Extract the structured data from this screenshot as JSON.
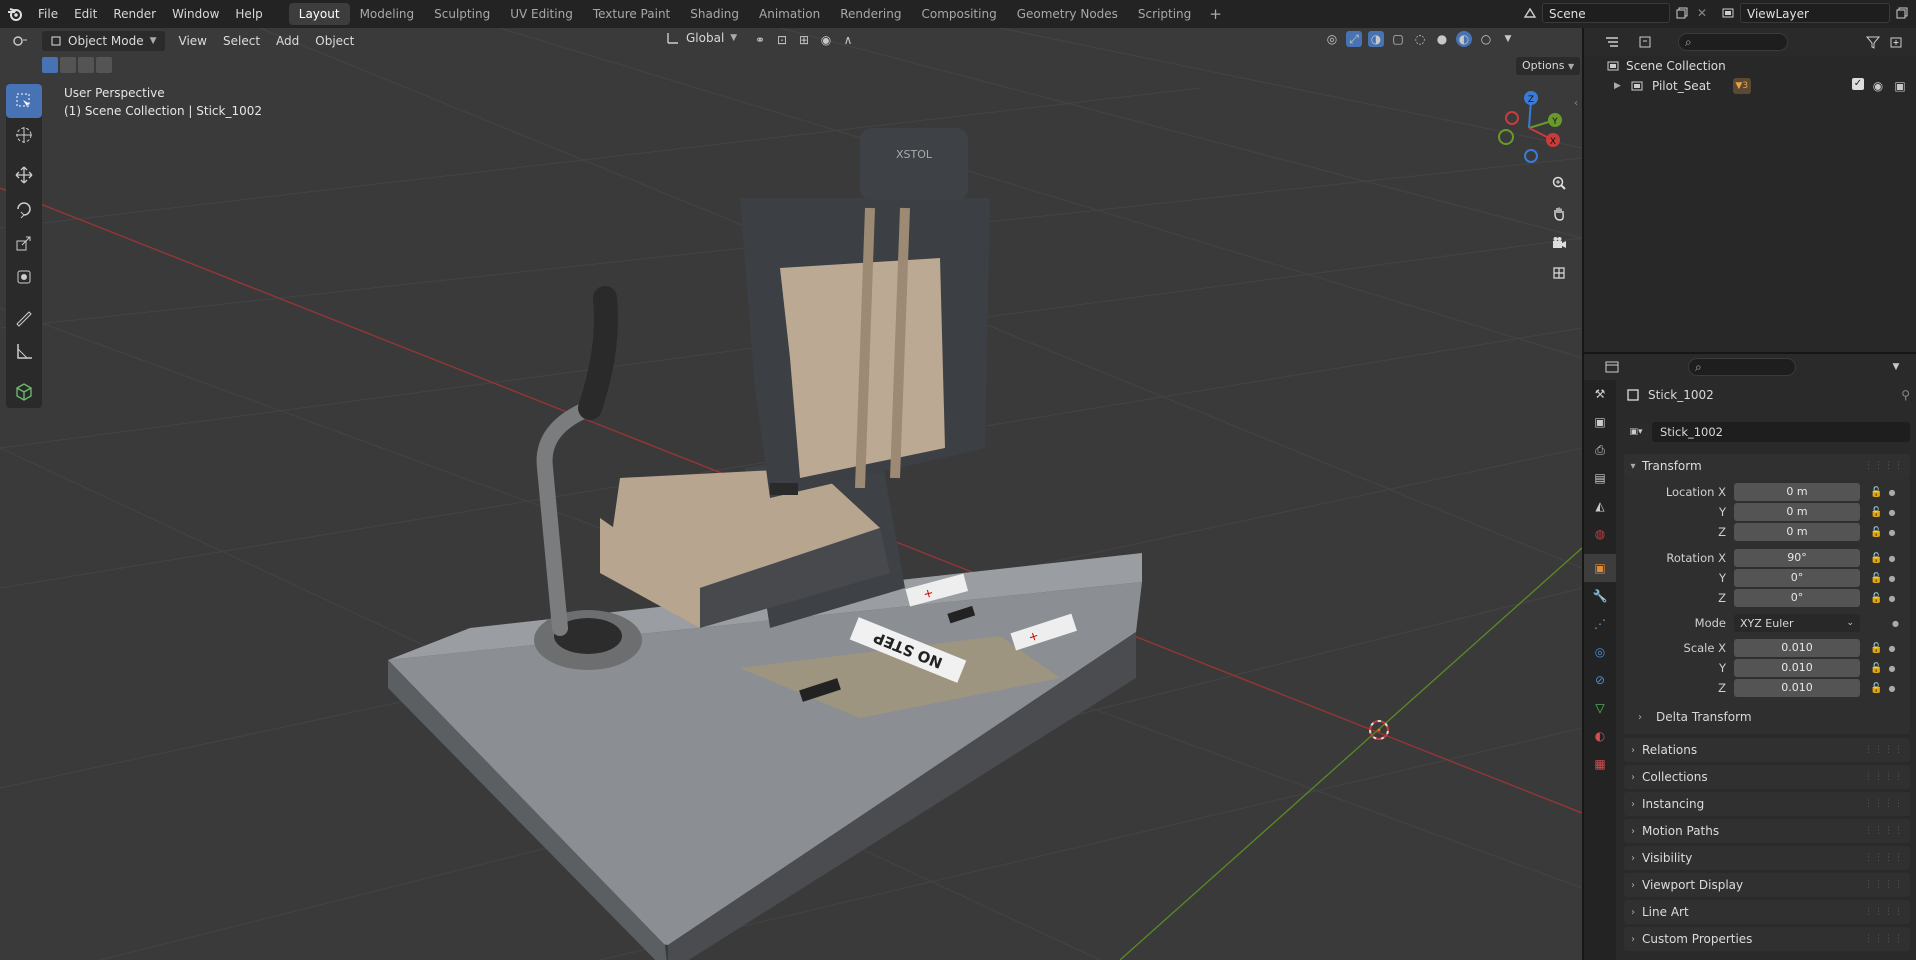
{
  "menu": [
    "File",
    "Edit",
    "Render",
    "Window",
    "Help"
  ],
  "workspaces": [
    {
      "label": "Layout",
      "active": true
    },
    {
      "label": "Modeling"
    },
    {
      "label": "Sculpting"
    },
    {
      "label": "UV Editing"
    },
    {
      "label": "Texture Paint"
    },
    {
      "label": "Shading"
    },
    {
      "label": "Animation"
    },
    {
      "label": "Rendering"
    },
    {
      "label": "Compositing"
    },
    {
      "label": "Geometry Nodes"
    },
    {
      "label": "Scripting"
    }
  ],
  "scene": {
    "name": "Scene",
    "view_layer": "ViewLayer"
  },
  "viewport": {
    "mode": "Object Mode",
    "menus": [
      "View",
      "Select",
      "Add",
      "Object"
    ],
    "orientation": "Global",
    "options_label": "Options",
    "perspective": "User Perspective",
    "collection_info": "(1) Scene Collection | Stick_1002",
    "gizmo_axes": {
      "x": "X",
      "y": "Y",
      "z": "Z"
    },
    "decals": {
      "no_step": "NO STEP",
      "brand": "XSTOL"
    }
  },
  "outliner": {
    "root": "Scene Collection",
    "items": [
      {
        "label": "Pilot_Seat",
        "badge": "3"
      }
    ]
  },
  "properties": {
    "object_name": "Stick_1002",
    "data_name": "Stick_1002",
    "transform_label": "Transform",
    "location": {
      "label": "Location X",
      "x": "0 m",
      "y": "0 m",
      "z": "0 m"
    },
    "rotation": {
      "label": "Rotation X",
      "x": "90°",
      "y": "0°",
      "z": "0°"
    },
    "mode_label": "Mode",
    "mode_value": "XYZ Euler",
    "scale": {
      "label": "Scale X",
      "x": "0.010",
      "y": "0.010",
      "z": "0.010"
    },
    "axis_y": "Y",
    "axis_z": "Z",
    "delta_transform": "Delta Transform",
    "sections": [
      "Relations",
      "Collections",
      "Instancing",
      "Motion Paths",
      "Visibility",
      "Viewport Display",
      "Line Art",
      "Custom Properties"
    ]
  },
  "colors": {
    "accent": "#4772b3",
    "x_axis": "#c83c3c",
    "y_axis": "#6a9a2b",
    "z_axis": "#3b7bd8",
    "object": "#e08c34"
  }
}
